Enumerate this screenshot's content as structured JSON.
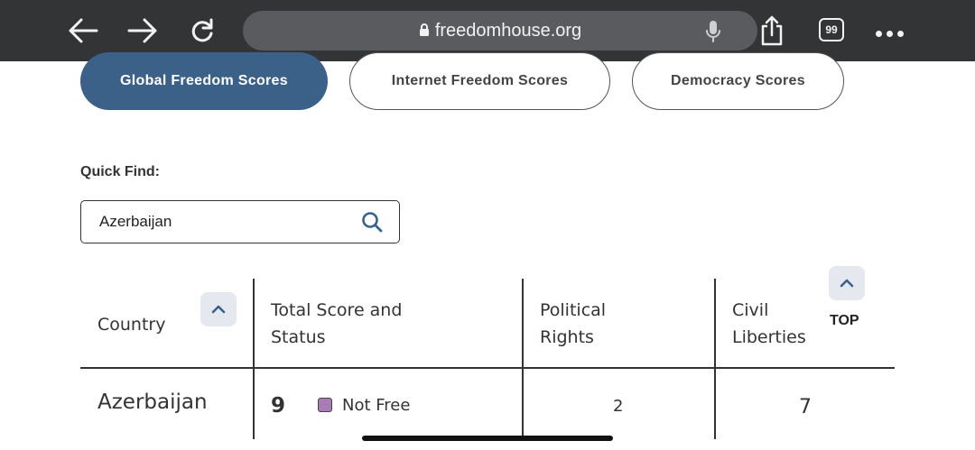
{
  "browser": {
    "url": "freedomhouse.org",
    "tab_count": "99",
    "icons": [
      "back-arrow-icon",
      "forward-arrow-icon",
      "reload-icon",
      "lock-icon",
      "microphone-icon",
      "share-icon",
      "tabs-icon",
      "more-icon"
    ]
  },
  "score_tabs": [
    {
      "label": "Global Freedom Scores",
      "active": true
    },
    {
      "label": "Internet Freedom Scores",
      "active": false
    },
    {
      "label": "Democracy Scores",
      "active": false
    }
  ],
  "quick_find": {
    "label": "Quick Find:",
    "value": "Azerbaijan"
  },
  "table": {
    "headers": {
      "country": "Country",
      "total_line1": "Total Score and",
      "total_line2": "Status",
      "political_line1": "Political",
      "political_line2": "Rights",
      "civil_line1": "Civil",
      "civil_line2": "Liberties"
    },
    "top_label": "TOP",
    "rows": [
      {
        "country": "Azerbaijan",
        "total": "9",
        "status": "Not Free",
        "status_color": "#a87db3",
        "political": "2",
        "civil": "7"
      }
    ]
  },
  "colors": {
    "active_tab": "#3c6189",
    "browser_bar": "#333435"
  }
}
